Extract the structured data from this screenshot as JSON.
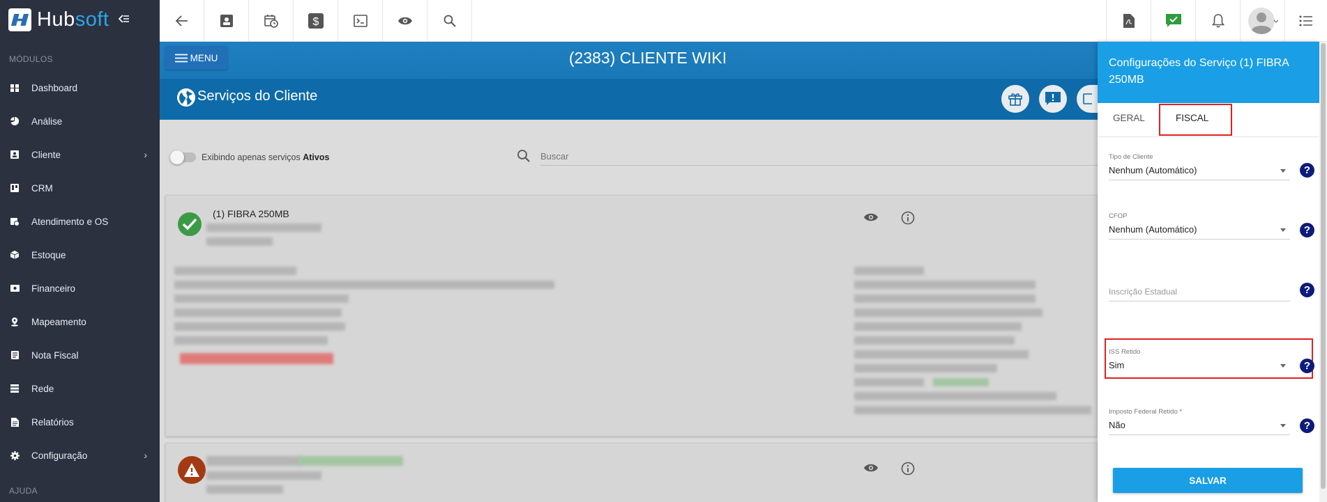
{
  "brand": {
    "hub": "Hub",
    "soft": "soft"
  },
  "sidebar": {
    "section_modules": "MÓDULOS",
    "section_help": "AJUDA",
    "items": [
      {
        "label": "Dashboard",
        "icon": "dashboard-icon"
      },
      {
        "label": "Análise",
        "icon": "pie-chart-icon"
      },
      {
        "label": "Cliente",
        "icon": "contact-card-icon",
        "chevron": true
      },
      {
        "label": "CRM",
        "icon": "trello-board-icon"
      },
      {
        "label": "Atendimento e OS",
        "icon": "calendar-clock-icon"
      },
      {
        "label": "Estoque",
        "icon": "box-icon"
      },
      {
        "label": "Financeiro",
        "icon": "money-icon"
      },
      {
        "label": "Mapeamento",
        "icon": "map-pin-icon"
      },
      {
        "label": "Nota Fiscal",
        "icon": "document-icon"
      },
      {
        "label": "Rede",
        "icon": "server-icon"
      },
      {
        "label": "Relatórios",
        "icon": "report-icon"
      },
      {
        "label": "Configuração",
        "icon": "gear-icon",
        "chevron": true
      }
    ]
  },
  "header": {
    "menu_label": "MENU",
    "client_title": "(2383) CLIENTE WIKI",
    "page_subtitle": "Serviços do Cliente"
  },
  "filters": {
    "toggle_text": "Exibindo apenas serviços ",
    "toggle_bold": "Ativos",
    "search_placeholder": "Buscar"
  },
  "services": [
    {
      "name": "(1) FIBRA 250MB",
      "status": "active"
    },
    {
      "name": "",
      "status": "warning"
    }
  ],
  "panel": {
    "title": "Configurações do Serviço (1) FIBRA 250MB",
    "tabs": [
      "GERAL",
      "FISCAL"
    ],
    "active_tab": "FISCAL",
    "fields": {
      "tipo_cliente": {
        "label": "Tipo de Cliente",
        "value": "Nenhum (Automático)"
      },
      "cfop": {
        "label": "CFOP",
        "value": "Nenhum (Automático)"
      },
      "inscricao_estadual": {
        "placeholder": "Inscrição Estadual"
      },
      "iss_retido": {
        "label": "ISS Retido",
        "value": "Sim"
      },
      "imposto_federal": {
        "label": "Imposto Federal Retido *",
        "value": "Não"
      }
    },
    "help_glyph": "?",
    "save_label": "SALVAR"
  },
  "colors": {
    "sidebar_bg": "#2c3140",
    "brand_blue": "#2ba7e8",
    "header_blue": "#1e7fc0",
    "panel_head": "#1a9ee6",
    "highlight_red": "#e02020",
    "help_navy": "#0d1b7a",
    "status_green": "#3b9b45",
    "status_warn": "#a33a14"
  }
}
